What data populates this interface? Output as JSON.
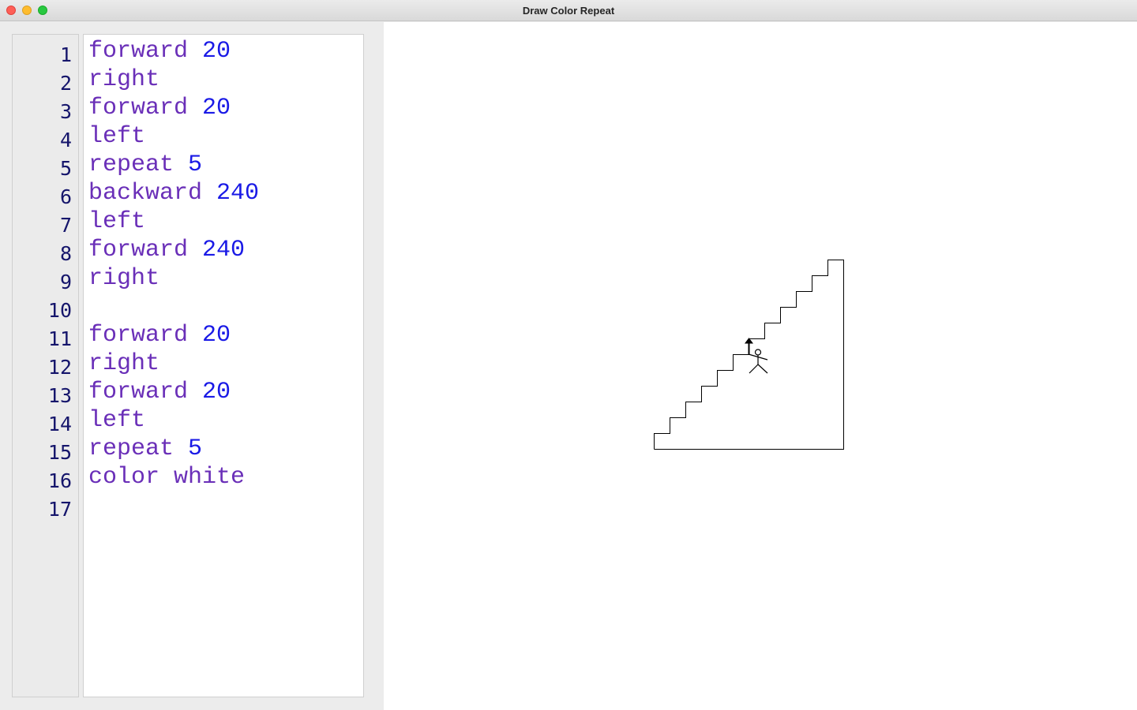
{
  "window": {
    "title": "Draw Color Repeat",
    "controls": [
      "close",
      "minimize",
      "zoom"
    ]
  },
  "editor": {
    "line_numbers": [
      "1",
      "2",
      "3",
      "4",
      "5",
      "6",
      "7",
      "8",
      "9",
      "10",
      "11",
      "12",
      "13",
      "14",
      "15",
      "16",
      "17"
    ],
    "lines": [
      {
        "keyword": "forward",
        "arg": "20"
      },
      {
        "keyword": "right",
        "arg": ""
      },
      {
        "keyword": "forward",
        "arg": "20"
      },
      {
        "keyword": "left",
        "arg": ""
      },
      {
        "keyword": "repeat",
        "arg": "5"
      },
      {
        "keyword": "backward",
        "arg": "240"
      },
      {
        "keyword": "left",
        "arg": ""
      },
      {
        "keyword": "forward",
        "arg": "240"
      },
      {
        "keyword": "right",
        "arg": ""
      },
      {
        "keyword": "",
        "arg": ""
      },
      {
        "keyword": "forward",
        "arg": "20"
      },
      {
        "keyword": "right",
        "arg": ""
      },
      {
        "keyword": "forward",
        "arg": "20"
      },
      {
        "keyword": "left",
        "arg": ""
      },
      {
        "keyword": "repeat",
        "arg": "5"
      },
      {
        "keyword": "color white",
        "arg": ""
      },
      {
        "keyword": "",
        "arg": ""
      }
    ],
    "colors": {
      "keyword": "#6a2fb8",
      "number": "#1a1ae6",
      "line_number": "#15156b"
    }
  },
  "canvas": {
    "icons": [
      "turtle-arrow-icon",
      "stick-figure-icon"
    ],
    "stroke_color": "#000000"
  }
}
